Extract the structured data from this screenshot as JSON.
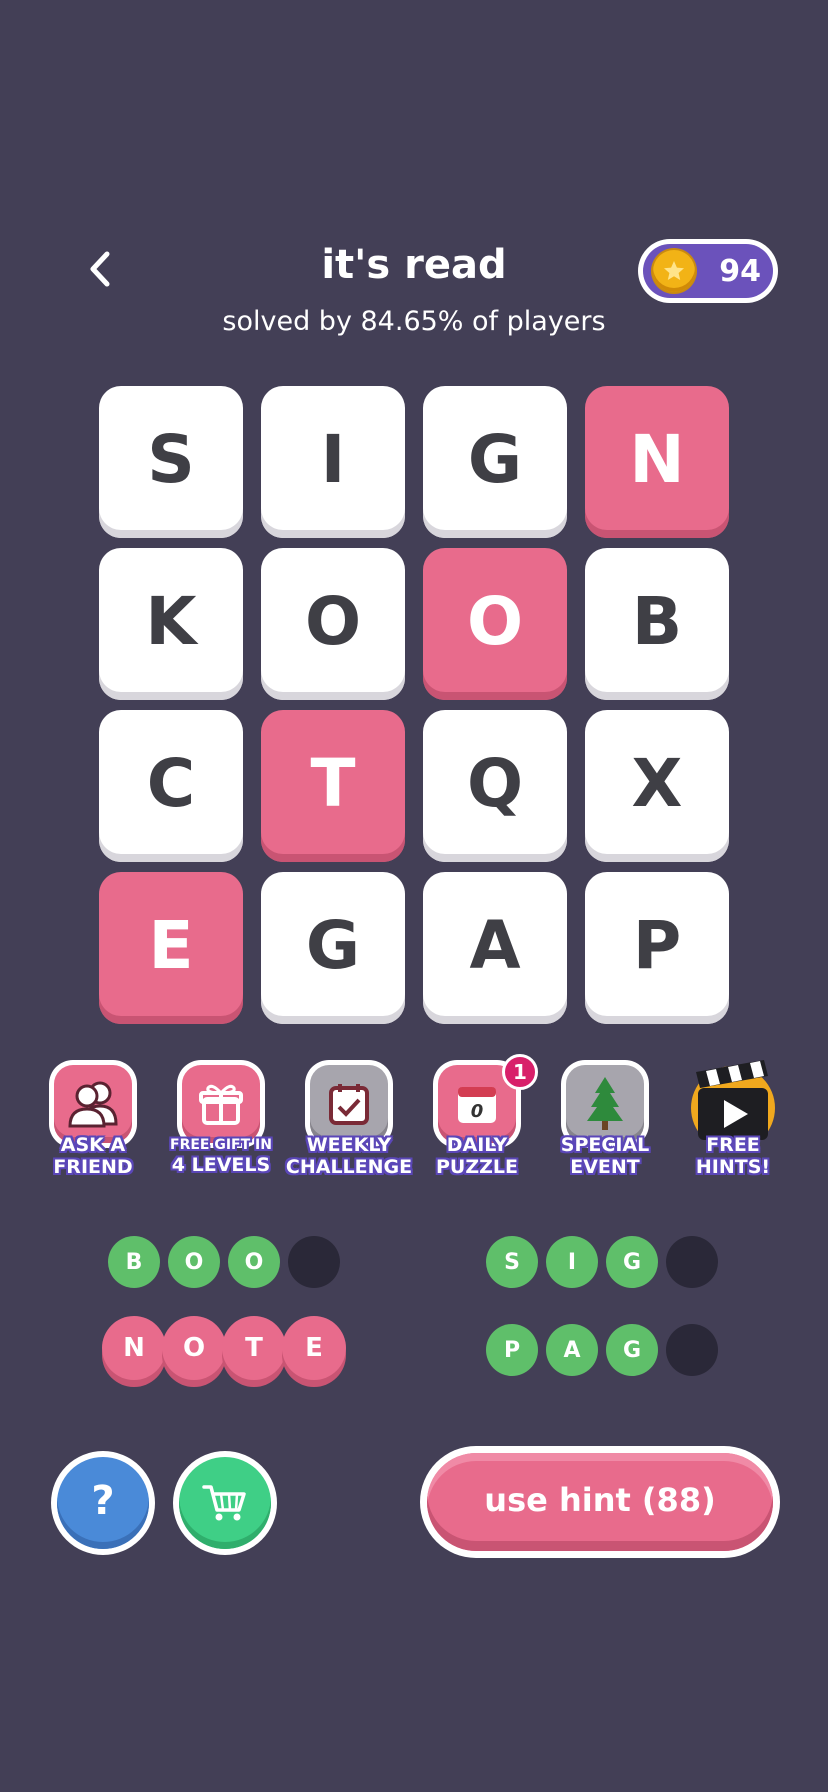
{
  "header": {
    "title": "it's read",
    "subtitle": "solved by 84.65% of players",
    "coins": "94"
  },
  "grid": [
    [
      "S",
      "I",
      "G",
      "N"
    ],
    [
      "K",
      "O",
      "O",
      "B"
    ],
    [
      "C",
      "T",
      "Q",
      "X"
    ],
    [
      "E",
      "G",
      "A",
      "P"
    ]
  ],
  "features": [
    {
      "line1": "ASK A",
      "line2": "FRIEND",
      "icon": "friends-icon"
    },
    {
      "line1": "FREE GIFT IN",
      "line2": "4 LEVELS",
      "icon": "gift-icon"
    },
    {
      "line1": "WEEKLY",
      "line2": "CHALLENGE",
      "icon": "calendar-check-icon"
    },
    {
      "line1": "DAILY",
      "line2": "PUZZLE",
      "icon": "daily-calendar-icon",
      "badge": "1",
      "calendar_digit": "0"
    },
    {
      "line1": "SPECIAL",
      "line2": "EVENT",
      "icon": "tree-icon"
    },
    {
      "line1": "FREE",
      "line2": "HINTS!",
      "icon": "clapperboard-icon"
    }
  ],
  "words": {
    "boo": [
      "B",
      "O",
      "O"
    ],
    "sig": [
      "S",
      "I",
      "G"
    ],
    "note": [
      "N",
      "O",
      "T",
      "E"
    ],
    "pag": [
      "P",
      "A",
      "G"
    ]
  },
  "buttons": {
    "help": "?",
    "hint": "use hint (88)"
  },
  "colors": {
    "background": "#433f56",
    "accent_pink": "#e86b8c",
    "found_green": "#5fbf6a",
    "coin_purple": "#6b52bb"
  }
}
